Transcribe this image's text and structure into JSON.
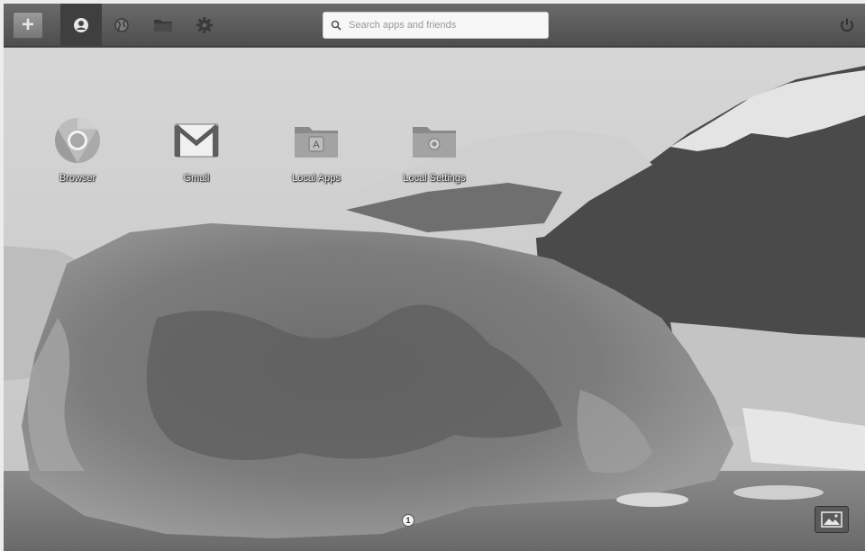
{
  "topbar": {
    "add_button": {
      "icon": "plus-icon",
      "glyph": "+"
    },
    "tabs": [
      {
        "id": "home",
        "icon": "home-dashboard-icon",
        "active": true
      },
      {
        "id": "globe",
        "icon": "globe-icon",
        "active": false
      },
      {
        "id": "folder",
        "icon": "folder-icon",
        "active": false
      },
      {
        "id": "settings",
        "icon": "gear-icon",
        "active": false
      }
    ],
    "search": {
      "placeholder": "Search apps and friends",
      "value": ""
    },
    "power": {
      "icon": "power-icon"
    }
  },
  "desktop": {
    "apps": [
      {
        "label": "Browser",
        "icon": "chrome-browser-icon"
      },
      {
        "label": "Gmail",
        "icon": "gmail-icon"
      },
      {
        "label": "Local Apps",
        "icon": "local-apps-folder-icon"
      },
      {
        "label": "Local Settings",
        "icon": "local-settings-folder-icon"
      }
    ],
    "page_indicator": "1",
    "wallpaper_button": {
      "icon": "picture-icon"
    }
  },
  "colors": {
    "topbar": "#555555",
    "active_tab": "#3f3f3f",
    "search_bg": "#f7f7f7"
  }
}
